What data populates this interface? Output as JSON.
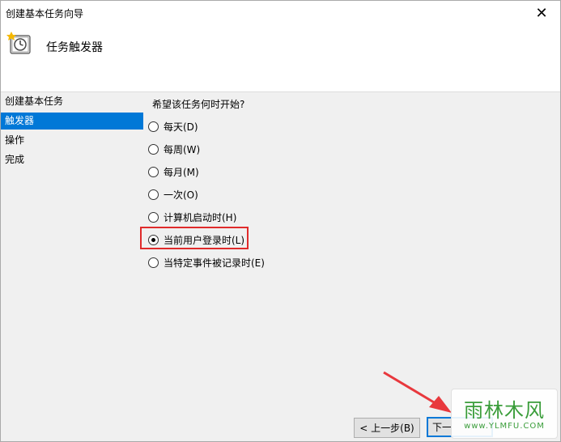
{
  "window": {
    "title": "创建基本任务向导",
    "close_glyph": "✕"
  },
  "header": {
    "title": "任务触发器",
    "icon": "clock-icon"
  },
  "sidebar": {
    "items": [
      {
        "label": "创建基本任务",
        "active": false
      },
      {
        "label": "触发器",
        "active": true
      },
      {
        "label": "操作",
        "active": false
      },
      {
        "label": "完成",
        "active": false
      }
    ]
  },
  "content": {
    "question": "希望该任务何时开始?",
    "options": [
      {
        "label": "每天(D)",
        "checked": false
      },
      {
        "label": "每周(W)",
        "checked": false
      },
      {
        "label": "每月(M)",
        "checked": false
      },
      {
        "label": "一次(O)",
        "checked": false
      },
      {
        "label": "计算机启动时(H)",
        "checked": false
      },
      {
        "label": "当前用户登录时(L)",
        "checked": true
      },
      {
        "label": "当特定事件被记录时(E)",
        "checked": false
      }
    ]
  },
  "buttons": {
    "back": "< 上一步(B)",
    "next": "下一"
  },
  "watermark": {
    "main": "雨林木风",
    "sub": "www.YLMFU.COM"
  },
  "colors": {
    "accent": "#0078d7",
    "highlight": "#e02b2b",
    "arrow": "#e8383d",
    "watermark": "#3a9d3a"
  }
}
